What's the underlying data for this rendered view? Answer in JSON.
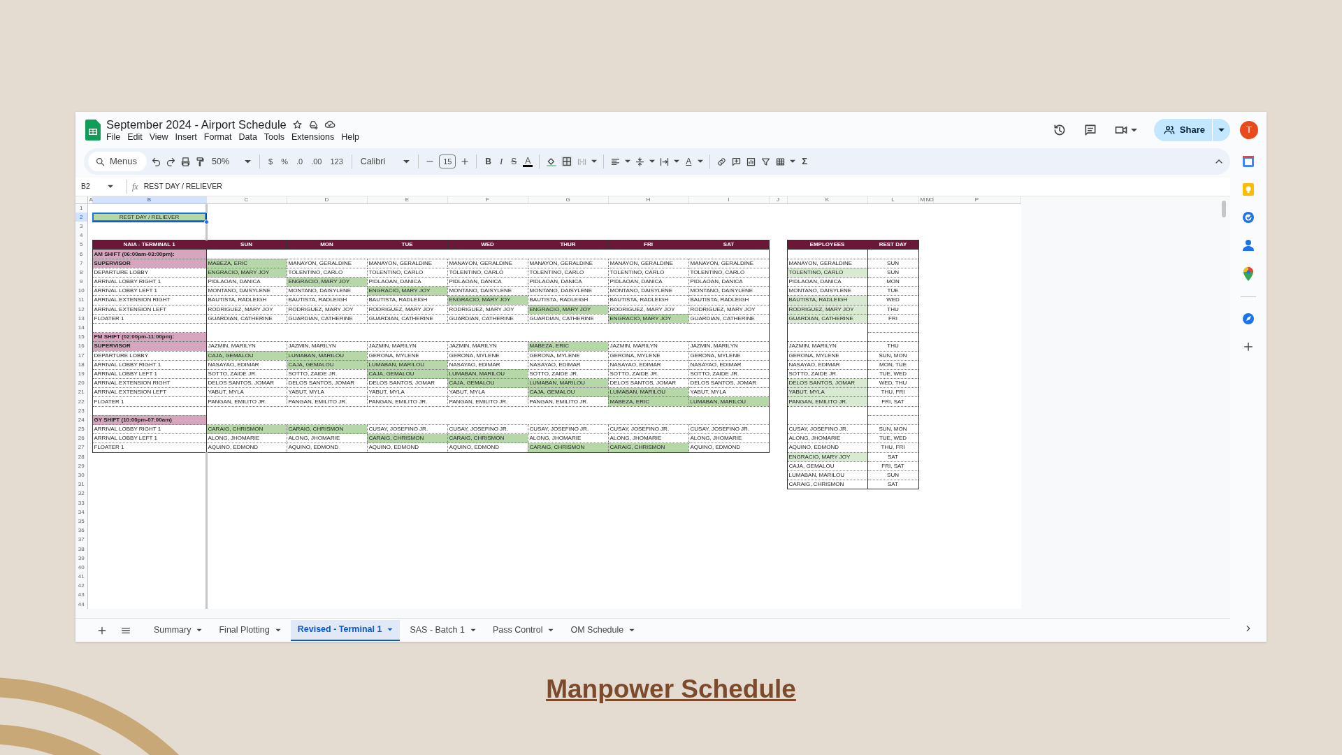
{
  "slide": {
    "title": "Manpower Schedule"
  },
  "window": {
    "title": "September 2024 - Airport Schedule",
    "menus": [
      "File",
      "Edit",
      "View",
      "Insert",
      "Format",
      "Data",
      "Tools",
      "Extensions",
      "Help"
    ],
    "share": "Share",
    "avatar": "T"
  },
  "toolbar": {
    "search": "Menus",
    "zoom": "50%",
    "currency": "$",
    "percent": "%",
    "decrease_decimals": ".0",
    "increase_decimals": ".00",
    "number_format": "123",
    "font": "Calibri",
    "font_size": "15",
    "bold": "B",
    "italic": "I",
    "strikethrough": "S",
    "text_color": "A",
    "rotate": "A",
    "functions": "Σ"
  },
  "formula_bar": {
    "cell": "B2",
    "fx": "fx",
    "value": "REST DAY / RELIEVER"
  },
  "columns": [
    {
      "label": "A",
      "selected": false
    },
    {
      "label": "B",
      "selected": true
    },
    {
      "label": "C",
      "selected": false
    },
    {
      "label": "D",
      "selected": false
    },
    {
      "label": "E",
      "selected": false
    },
    {
      "label": "F",
      "selected": false
    },
    {
      "label": "G",
      "selected": false
    },
    {
      "label": "H",
      "selected": false
    },
    {
      "label": "I",
      "selected": false
    },
    {
      "label": "J",
      "selected": false
    },
    {
      "label": "K",
      "selected": false
    },
    {
      "label": "L",
      "selected": false
    },
    {
      "label": "M",
      "selected": false
    },
    {
      "label": "N",
      "selected": false
    },
    {
      "label": "O",
      "selected": false
    },
    {
      "label": "P",
      "selected": false
    }
  ],
  "rows": [
    {
      "label": "1",
      "selected": false
    },
    {
      "label": "2",
      "selected": true
    },
    {
      "label": "3",
      "selected": false
    },
    {
      "label": "4",
      "selected": false
    },
    {
      "label": "5",
      "selected": false
    },
    {
      "label": "6",
      "selected": false
    },
    {
      "label": "7",
      "selected": false
    },
    {
      "label": "8",
      "selected": false
    },
    {
      "label": "9",
      "selected": false
    },
    {
      "label": "10",
      "selected": false
    },
    {
      "label": "11",
      "selected": false
    },
    {
      "label": "12",
      "selected": false
    },
    {
      "label": "13",
      "selected": false
    },
    {
      "label": "14",
      "selected": false
    },
    {
      "label": "15",
      "selected": false
    },
    {
      "label": "16",
      "selected": false
    },
    {
      "label": "17",
      "selected": false
    },
    {
      "label": "18",
      "selected": false
    },
    {
      "label": "19",
      "selected": false
    },
    {
      "label": "20",
      "selected": false
    },
    {
      "label": "21",
      "selected": false
    },
    {
      "label": "22",
      "selected": false
    },
    {
      "label": "23",
      "selected": false
    },
    {
      "label": "24",
      "selected": false
    },
    {
      "label": "25",
      "selected": false
    },
    {
      "label": "26",
      "selected": false
    },
    {
      "label": "27",
      "selected": false
    },
    {
      "label": "28",
      "selected": false
    },
    {
      "label": "29",
      "selected": false
    },
    {
      "label": "30",
      "selected": false
    },
    {
      "label": "31",
      "selected": false
    },
    {
      "label": "32",
      "selected": false
    },
    {
      "label": "33",
      "selected": false
    },
    {
      "label": "34",
      "selected": false
    },
    {
      "label": "35",
      "selected": false
    },
    {
      "label": "36",
      "selected": false
    },
    {
      "label": "37",
      "selected": false
    },
    {
      "label": "38",
      "selected": false
    },
    {
      "label": "39",
      "selected": false
    },
    {
      "label": "40",
      "selected": false
    },
    {
      "label": "41",
      "selected": false
    },
    {
      "label": "42",
      "selected": false
    },
    {
      "label": "43",
      "selected": false
    },
    {
      "label": "44",
      "selected": false
    }
  ],
  "legend": {
    "text": "REST DAY / RELIEVER",
    "selected": true
  },
  "schedule": {
    "header": [
      "NAIA - TERMINAL 1",
      "SUN",
      "MON",
      "TUE",
      "WED",
      "THUR",
      "FRI",
      "SAT"
    ],
    "sections": [
      {
        "title": "AM SHIFT (06:00am-03:00pm):",
        "rows": [
          {
            "post": "SUPERVISOR",
            "highlighted": true,
            "cells": [
              {
                "name": "MABEZA, ERIC",
                "relief": true
              },
              {
                "name": "MANAYON, GERALDINE",
                "relief": false
              },
              {
                "name": "MANAYON, GERALDINE",
                "relief": false
              },
              {
                "name": "MANAYON, GERALDINE",
                "relief": false
              },
              {
                "name": "MANAYON, GERALDINE",
                "relief": false
              },
              {
                "name": "MANAYON, GERALDINE",
                "relief": false
              },
              {
                "name": "MANAYON, GERALDINE",
                "relief": false
              }
            ]
          },
          {
            "post": "DEPARTURE LOBBY",
            "highlighted": false,
            "cells": [
              {
                "name": "ENGRACIO, MARY JOY",
                "relief": true
              },
              {
                "name": "TOLENTINO, CARLO",
                "relief": false
              },
              {
                "name": "TOLENTINO, CARLO",
                "relief": false
              },
              {
                "name": "TOLENTINO, CARLO",
                "relief": false
              },
              {
                "name": "TOLENTINO, CARLO",
                "relief": false
              },
              {
                "name": "TOLENTINO, CARLO",
                "relief": false
              },
              {
                "name": "TOLENTINO, CARLO",
                "relief": false
              }
            ]
          },
          {
            "post": "ARRIVAL LOBBY RIGHT 1",
            "highlighted": false,
            "cells": [
              {
                "name": "PIDLAOAN, DANICA",
                "relief": false
              },
              {
                "name": "ENGRACIO, MARY JOY",
                "relief": true
              },
              {
                "name": "PIDLAOAN, DANICA",
                "relief": false
              },
              {
                "name": "PIDLAOAN, DANICA",
                "relief": false
              },
              {
                "name": "PIDLAOAN, DANICA",
                "relief": false
              },
              {
                "name": "PIDLAOAN, DANICA",
                "relief": false
              },
              {
                "name": "PIDLAOAN, DANICA",
                "relief": false
              }
            ]
          },
          {
            "post": "ARRIVAL LOBBY LEFT 1",
            "highlighted": false,
            "cells": [
              {
                "name": "MONTANO, DAISYLENE",
                "relief": false
              },
              {
                "name": "MONTANO, DAISYLENE",
                "relief": false
              },
              {
                "name": "ENGRACIO, MARY JOY",
                "relief": true
              },
              {
                "name": "MONTANO, DAISYLENE",
                "relief": false
              },
              {
                "name": "MONTANO, DAISYLENE",
                "relief": false
              },
              {
                "name": "MONTANO, DAISYLENE",
                "relief": false
              },
              {
                "name": "MONTANO, DAISYLENE",
                "relief": false
              }
            ]
          },
          {
            "post": "ARRIVAL EXTENSION RIGHT",
            "highlighted": false,
            "cells": [
              {
                "name": "BAUTISTA, RADLEIGH",
                "relief": false
              },
              {
                "name": "BAUTISTA, RADLEIGH",
                "relief": false
              },
              {
                "name": "BAUTISTA, RADLEIGH",
                "relief": false
              },
              {
                "name": "ENGRACIO, MARY JOY",
                "relief": true
              },
              {
                "name": "BAUTISTA, RADLEIGH",
                "relief": false
              },
              {
                "name": "BAUTISTA, RADLEIGH",
                "relief": false
              },
              {
                "name": "BAUTISTA, RADLEIGH",
                "relief": false
              }
            ]
          },
          {
            "post": "ARRIVAL EXTENSION LEFT",
            "highlighted": false,
            "cells": [
              {
                "name": "RODRIGUEZ, MARY JOY",
                "relief": false
              },
              {
                "name": "RODRIGUEZ, MARY JOY",
                "relief": false
              },
              {
                "name": "RODRIGUEZ, MARY JOY",
                "relief": false
              },
              {
                "name": "RODRIGUEZ, MARY JOY",
                "relief": false
              },
              {
                "name": "ENGRACIO, MARY JOY",
                "relief": true
              },
              {
                "name": "RODRIGUEZ, MARY JOY",
                "relief": false
              },
              {
                "name": "RODRIGUEZ, MARY JOY",
                "relief": false
              }
            ]
          },
          {
            "post": "FLOATER 1",
            "highlighted": false,
            "cells": [
              {
                "name": "GUARDIAN, CATHERINE",
                "relief": false
              },
              {
                "name": "GUARDIAN, CATHERINE",
                "relief": false
              },
              {
                "name": "GUARDIAN, CATHERINE",
                "relief": false
              },
              {
                "name": "GUARDIAN, CATHERINE",
                "relief": false
              },
              {
                "name": "GUARDIAN, CATHERINE",
                "relief": false
              },
              {
                "name": "ENGRACIO, MARY JOY",
                "relief": true
              },
              {
                "name": "GUARDIAN, CATHERINE",
                "relief": false
              }
            ]
          }
        ]
      },
      {
        "title": "PM SHIFT (02:00pm-11:00pm):",
        "rows": [
          {
            "post": "SUPERVISOR",
            "highlighted": true,
            "cells": [
              {
                "name": "JAZMIN, MARILYN",
                "relief": false
              },
              {
                "name": "JAZMIN, MARILYN",
                "relief": false
              },
              {
                "name": "JAZMIN, MARILYN",
                "relief": false
              },
              {
                "name": "JAZMIN, MARILYN",
                "relief": false
              },
              {
                "name": "MABEZA, ERIC",
                "relief": true
              },
              {
                "name": "JAZMIN, MARILYN",
                "relief": false
              },
              {
                "name": "JAZMIN, MARILYN",
                "relief": false
              }
            ]
          },
          {
            "post": "DEPARTURE LOBBY",
            "highlighted": false,
            "cells": [
              {
                "name": "CAJA, GEMALOU",
                "relief": true
              },
              {
                "name": "LUMABAN, MARILOU",
                "relief": true
              },
              {
                "name": "GERONA, MYLENE",
                "relief": false
              },
              {
                "name": "GERONA, MYLENE",
                "relief": false
              },
              {
                "name": "GERONA, MYLENE",
                "relief": false
              },
              {
                "name": "GERONA, MYLENE",
                "relief": false
              },
              {
                "name": "GERONA, MYLENE",
                "relief": false
              }
            ]
          },
          {
            "post": "ARRIVAL LOBBY RIGHT 1",
            "highlighted": false,
            "cells": [
              {
                "name": "NASAYAO, EDIMAR",
                "relief": false
              },
              {
                "name": "CAJA, GEMALOU",
                "relief": true
              },
              {
                "name": "LUMABAN, MARILOU",
                "relief": true
              },
              {
                "name": "NASAYAO, EDIMAR",
                "relief": false
              },
              {
                "name": "NASAYAO, EDIMAR",
                "relief": false
              },
              {
                "name": "NASAYAO, EDIMAR",
                "relief": false
              },
              {
                "name": "NASAYAO, EDIMAR",
                "relief": false
              }
            ]
          },
          {
            "post": "ARRIVAL LOBBY LEFT 1",
            "highlighted": false,
            "cells": [
              {
                "name": "SOTTO, ZAIDE JR.",
                "relief": false
              },
              {
                "name": "SOTTO, ZAIDE JR.",
                "relief": false
              },
              {
                "name": "CAJA, GEMALOU",
                "relief": true
              },
              {
                "name": "LUMABAN, MARILOU",
                "relief": true
              },
              {
                "name": "SOTTO, ZAIDE JR.",
                "relief": false
              },
              {
                "name": "SOTTO, ZAIDE JR.",
                "relief": false
              },
              {
                "name": "SOTTO, ZAIDE JR.",
                "relief": false
              }
            ]
          },
          {
            "post": "ARRIVAL EXTENSION RIGHT",
            "highlighted": false,
            "cells": [
              {
                "name": "DELOS SANTOS, JOMAR",
                "relief": false
              },
              {
                "name": "DELOS SANTOS, JOMAR",
                "relief": false
              },
              {
                "name": "DELOS SANTOS, JOMAR",
                "relief": false
              },
              {
                "name": "CAJA, GEMALOU",
                "relief": true
              },
              {
                "name": "LUMABAN, MARILOU",
                "relief": true
              },
              {
                "name": "DELOS SANTOS, JOMAR",
                "relief": false
              },
              {
                "name": "DELOS SANTOS, JOMAR",
                "relief": false
              }
            ]
          },
          {
            "post": "ARRIVAL EXTENSION LEFT",
            "highlighted": false,
            "cells": [
              {
                "name": "YABUT, MYLA",
                "relief": false
              },
              {
                "name": "YABUT, MYLA",
                "relief": false
              },
              {
                "name": "YABUT, MYLA",
                "relief": false
              },
              {
                "name": "YABUT, MYLA",
                "relief": false
              },
              {
                "name": "CAJA, GEMALOU",
                "relief": true
              },
              {
                "name": "LUMABAN, MARILOU",
                "relief": true
              },
              {
                "name": "YABUT, MYLA",
                "relief": false
              }
            ]
          },
          {
            "post": "FLOATER 1",
            "highlighted": false,
            "cells": [
              {
                "name": "PANGAN, EMILITO JR.",
                "relief": false
              },
              {
                "name": "PANGAN, EMILITO JR.",
                "relief": false
              },
              {
                "name": "PANGAN, EMILITO JR.",
                "relief": false
              },
              {
                "name": "PANGAN, EMILITO JR.",
                "relief": false
              },
              {
                "name": "PANGAN, EMILITO JR.",
                "relief": false
              },
              {
                "name": "MABEZA, ERIC",
                "relief": true
              },
              {
                "name": "LUMABAN, MARILOU",
                "relief": true
              }
            ]
          }
        ]
      },
      {
        "title": "GY SHIFT (10:00pm-07:00am)",
        "rows": [
          {
            "post": "ARRIVAL LOBBY RIGHT 1",
            "highlighted": false,
            "cells": [
              {
                "name": "CARAIG, CHRISMON",
                "relief": true
              },
              {
                "name": "CARAIG, CHRISMON",
                "relief": true
              },
              {
                "name": "CUSAY, JOSEFINO JR.",
                "relief": false
              },
              {
                "name": "CUSAY, JOSEFINO JR.",
                "relief": false
              },
              {
                "name": "CUSAY, JOSEFINO JR.",
                "relief": false
              },
              {
                "name": "CUSAY, JOSEFINO JR.",
                "relief": false
              },
              {
                "name": "CUSAY, JOSEFINO JR.",
                "relief": false
              }
            ]
          },
          {
            "post": "ARRIVAL LOBBY LEFT 1",
            "highlighted": false,
            "cells": [
              {
                "name": "ALONG, JHOMARIE",
                "relief": false
              },
              {
                "name": "ALONG, JHOMARIE",
                "relief": false
              },
              {
                "name": "CARAIG, CHRISMON",
                "relief": true
              },
              {
                "name": "CARAIG, CHRISMON",
                "relief": true
              },
              {
                "name": "ALONG, JHOMARIE",
                "relief": false
              },
              {
                "name": "ALONG, JHOMARIE",
                "relief": false
              },
              {
                "name": "ALONG, JHOMARIE",
                "relief": false
              }
            ]
          },
          {
            "post": "FLOATER 1",
            "highlighted": false,
            "cells": [
              {
                "name": "AQUINO, EDMOND",
                "relief": false
              },
              {
                "name": "AQUINO, EDMOND",
                "relief": false
              },
              {
                "name": "AQUINO, EDMOND",
                "relief": false
              },
              {
                "name": "AQUINO, EDMOND",
                "relief": false
              },
              {
                "name": "CARAIG, CHRISMON",
                "relief": true
              },
              {
                "name": "CARAIG, CHRISMON",
                "relief": true
              },
              {
                "name": "AQUINO, EDMOND",
                "relief": false
              }
            ]
          }
        ]
      }
    ]
  },
  "employees": {
    "header": [
      "EMPLOYEES",
      "REST DAY"
    ],
    "groups": [
      [
        {
          "name": "MANAYON, GERALDINE",
          "rest_day": "SUN",
          "relief": false
        },
        {
          "name": "TOLENTINO, CARLO",
          "rest_day": "SUN",
          "relief": true
        },
        {
          "name": "PIDLAOAN, DANICA",
          "rest_day": "MON",
          "relief": false
        },
        {
          "name": "MONTANO, DAISYLENE",
          "rest_day": "TUE",
          "relief": false
        },
        {
          "name": "BAUTISTA, RADLEIGH",
          "rest_day": "WED",
          "relief": true
        },
        {
          "name": "RODRIGUEZ, MARY JOY",
          "rest_day": "THU",
          "relief": true
        },
        {
          "name": "GUARDIAN, CATHERINE",
          "rest_day": "FRI",
          "relief": true
        }
      ],
      [
        {
          "name": "JAZMIN, MARILYN",
          "rest_day": "THU",
          "relief": false
        },
        {
          "name": "GERONA, MYLENE",
          "rest_day": "SUN, MON",
          "relief": false
        },
        {
          "name": "NASAYAO, EDIMAR",
          "rest_day": "MON, TUE",
          "relief": false
        },
        {
          "name": "SOTTO, ZAIDE JR.",
          "rest_day": "TUE, WED",
          "relief": false
        },
        {
          "name": "DELOS SANTOS, JOMAR",
          "rest_day": "WED, THU",
          "relief": true
        },
        {
          "name": "YABUT, MYLA",
          "rest_day": "THU, FRI",
          "relief": true
        },
        {
          "name": "PANGAN, EMILITO JR.",
          "rest_day": "FRI, SAT",
          "relief": true
        }
      ],
      [
        {
          "name": "CUSAY, JOSEFINO JR.",
          "rest_day": "SUN, MON",
          "relief": false
        },
        {
          "name": "ALONG, JHOMARIE",
          "rest_day": "TUE, WED",
          "relief": false
        },
        {
          "name": "AQUINO, EDMOND",
          "rest_day": "THU, FRI",
          "relief": false
        },
        {
          "name": "ENGRACIO, MARY JOY",
          "rest_day": "SAT",
          "relief": true
        },
        {
          "name": "CAJA, GEMALOU",
          "rest_day": "FRI, SAT",
          "relief": false
        },
        {
          "name": "LUMABAN, MARILOU",
          "rest_day": "SUN",
          "relief": false
        },
        {
          "name": "CARAIG, CHRISMON",
          "rest_day": "SAT",
          "relief": false
        }
      ]
    ]
  },
  "sheet_tabs": [
    {
      "label": "Summary",
      "selected": false
    },
    {
      "label": "Final Plotting",
      "selected": false
    },
    {
      "label": "Revised - Terminal 1",
      "selected": true
    },
    {
      "label": "SAS - Batch 1",
      "selected": false
    },
    {
      "label": "Pass Control",
      "selected": false
    },
    {
      "label": "OM Schedule",
      "selected": false
    }
  ]
}
